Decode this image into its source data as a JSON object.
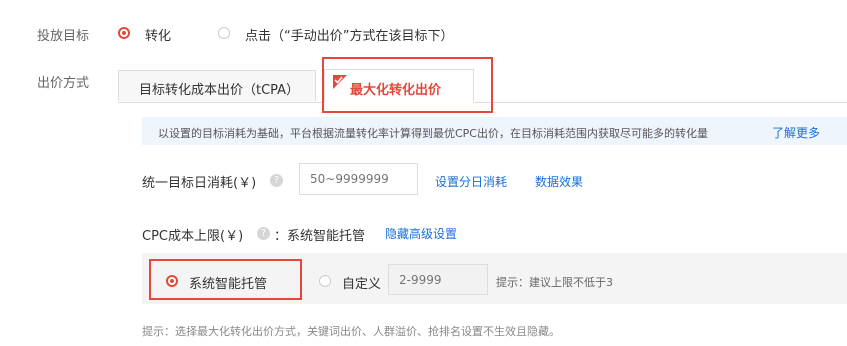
{
  "row_goal": {
    "label": "投放目标",
    "options": [
      {
        "label": "转化",
        "selected": true
      },
      {
        "label": "点击（“手动出价”方式在该目标下）",
        "selected": false
      }
    ]
  },
  "row_bid": {
    "label": "出价方式",
    "tabs": [
      {
        "label": "目标转化成本出价（tCPA）",
        "active": false
      },
      {
        "label": "最大化转化出价",
        "active": true
      }
    ]
  },
  "info": {
    "text": "以设置的目标消耗为基础，平台根据流量转化率计算得到最优CPC出价，在目标消耗范围内获取尽可能多的转化量",
    "link": "了解更多"
  },
  "budget": {
    "label": "统一目标日消耗(￥)",
    "help": "?",
    "placeholder": "50~9999999",
    "link1": "设置分日消耗",
    "link2": "数据效果"
  },
  "cpc": {
    "label": "CPC成本上限(￥)",
    "help": "?",
    "value": "：系统智能托管",
    "link": "隐藏高级设置",
    "opt_auto": "系统智能托管",
    "opt_custom": "自定义",
    "custom_placeholder": "2-9999",
    "hint": "提示：建议上限不低于3"
  },
  "footer_hint": "提示：选择最大化转化出价方式，关键词出价、人群溢价、抢排名设置不生效且隐藏。",
  "colors": {
    "accent": "#e3493b",
    "link": "#1a6fd4"
  }
}
